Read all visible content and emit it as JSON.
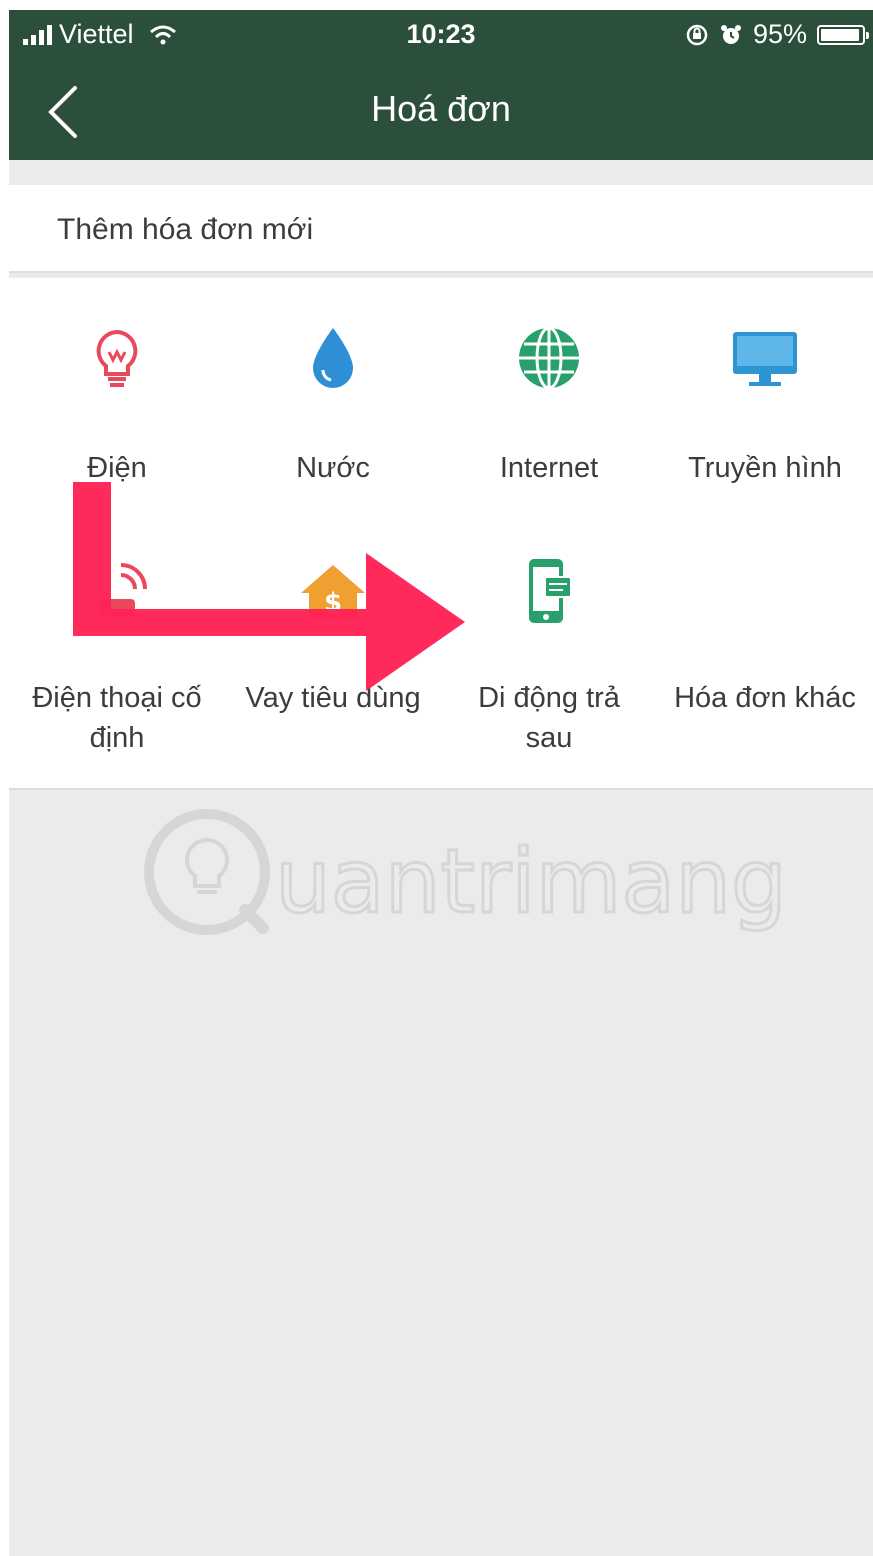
{
  "status_bar": {
    "carrier": "Viettel",
    "time": "10:23",
    "battery": "95%",
    "battery_level": 0.95
  },
  "header": {
    "title": "Hoá đơn",
    "back_icon": "chevron-left-icon"
  },
  "add_bill": {
    "label": "Thêm hóa đơn mới"
  },
  "categories": [
    {
      "label": "Điện",
      "icon": "lightbulb-icon",
      "color": "#e9495b"
    },
    {
      "label": "Nước",
      "icon": "water-drop-icon",
      "color": "#2f8fd6"
    },
    {
      "label": "Internet",
      "icon": "globe-icon",
      "color": "#27a06b"
    },
    {
      "label": "Truyền hình",
      "icon": "monitor-icon",
      "color": "#2e95d3"
    },
    {
      "label": "Điện thoại cố định",
      "label_line1": "Điện thoại cố",
      "label_line2": "định",
      "icon": "landline-phone-icon",
      "color": "#e9495b"
    },
    {
      "label": "Vay tiêu dùng",
      "icon": "house-dollar-icon",
      "color": "#f0a030"
    },
    {
      "label": "Di động trả sau",
      "label_line1": "Di động trả",
      "label_line2": "sau",
      "icon": "mobile-bill-icon",
      "color": "#27a06b"
    },
    {
      "label": "Hóa đơn khác",
      "icon": "",
      "color": ""
    }
  ],
  "annotation": {
    "arrow_color": "#ff2257",
    "arrow_icon": "red-arrow-annotation"
  },
  "watermark": {
    "text": "uantrimang",
    "logo": "Q-lightbulb-logo"
  },
  "colors": {
    "header_bg": "#2c4f3b",
    "page_bg": "#ebebeb"
  }
}
